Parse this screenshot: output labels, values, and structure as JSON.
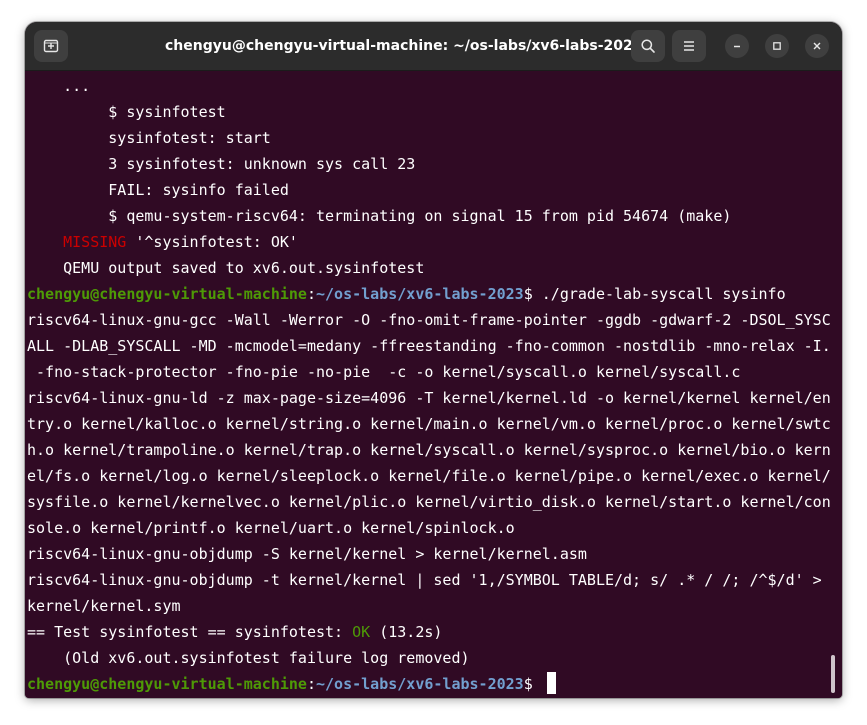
{
  "window": {
    "title": "chengyu@chengyu-virtual-machine: ~/os-labs/xv6-labs-2023"
  },
  "icons": {
    "new_tab": "new-tab-icon",
    "search": "search-icon",
    "menu": "hamburger-menu-icon",
    "minimize": "minimize-icon",
    "maximize": "maximize-icon",
    "close": "close-icon"
  },
  "colors": {
    "terminal_bg": "#300a24",
    "titlebar_bg": "#2c2c2c",
    "prompt_user": "#4e9a06",
    "prompt_path": "#729fcf",
    "missing": "#cc0000",
    "ok": "#4e9a06"
  },
  "terminal": {
    "prompt": {
      "user": "chengyu@chengyu-virtual-machine",
      "colon": ":",
      "path": "~/os-labs/xv6-labs-2023",
      "symbol": "$ "
    },
    "lines": [
      "    ...",
      "         $ sysinfotest",
      "         sysinfotest: start",
      "         3 sysinfotest: unknown sys call 23",
      "         FAIL: sysinfo failed",
      "         $ qemu-system-riscv64: terminating on signal 15 from pid 54674 (make)",
      "'^sysinfotest: OK'",
      "    QEMU output saved to xv6.out.sysinfotest",
      "./grade-lab-syscall sysinfo",
      "riscv64-linux-gnu-gcc -Wall -Werror -O -fno-omit-frame-pointer -ggdb -gdwarf-2 -DSOL_SYSC",
      "ALL -DLAB_SYSCALL -MD -mcmodel=medany -ffreestanding -fno-common -nostdlib -mno-relax -I.",
      " -fno-stack-protector -fno-pie -no-pie  -c -o kernel/syscall.o kernel/syscall.c",
      "riscv64-linux-gnu-ld -z max-page-size=4096 -T kernel/kernel.ld -o kernel/kernel kernel/en",
      "try.o kernel/kalloc.o kernel/string.o kernel/main.o kernel/vm.o kernel/proc.o kernel/swtc",
      "h.o kernel/trampoline.o kernel/trap.o kernel/syscall.o kernel/sysproc.o kernel/bio.o kern",
      "el/fs.o kernel/log.o kernel/sleeplock.o kernel/file.o kernel/pipe.o kernel/exec.o kernel/",
      "sysfile.o kernel/kernelvec.o kernel/plic.o kernel/virtio_disk.o kernel/start.o kernel/con",
      "sole.o kernel/printf.o kernel/uart.o kernel/spinlock.o",
      "riscv64-linux-gnu-objdump -S kernel/kernel > kernel/kernel.asm",
      "riscv64-linux-gnu-objdump -t kernel/kernel | sed '1,/SYMBOL TABLE/d; s/ .* / /; /^$/d' >",
      "kernel/kernel.sym",
      "== Test sysinfotest == sysinfotest: ",
      " (13.2s)",
      "    (Old xv6.out.sysinfotest failure log removed)"
    ],
    "missing_indent": "    ",
    "missing_word": "MISSING",
    "missing_gap": " ",
    "ok_word": "OK"
  }
}
